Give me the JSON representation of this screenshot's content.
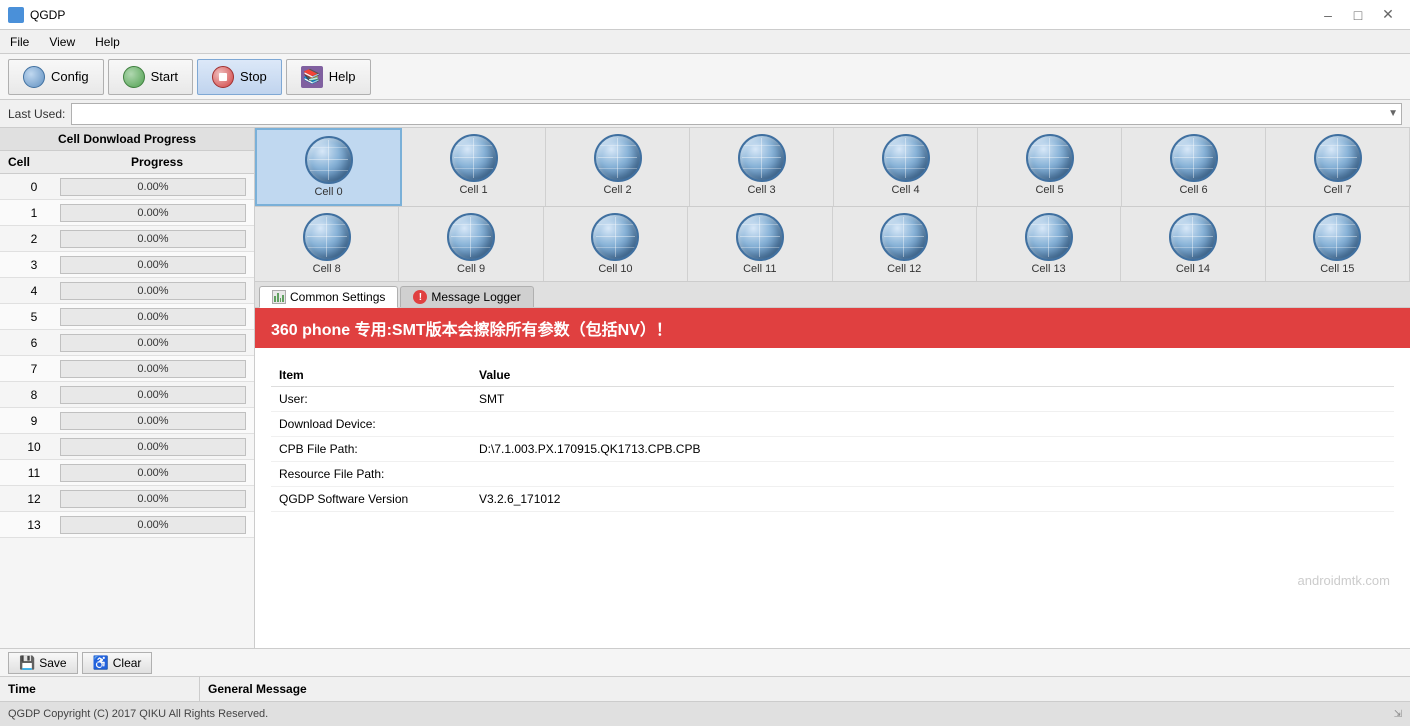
{
  "app": {
    "title": "QGDP",
    "menu": [
      "File",
      "View",
      "Help"
    ]
  },
  "toolbar": {
    "config_label": "Config",
    "start_label": "Start",
    "stop_label": "Stop",
    "help_label": "Help"
  },
  "last_used": {
    "label": "Last Used:",
    "value": "",
    "placeholder": ""
  },
  "left_panel": {
    "title": "Cell Donwload Progress",
    "header_cell": "Cell",
    "header_progress": "Progress",
    "cells": [
      {
        "num": 0,
        "progress": "0.00%"
      },
      {
        "num": 1,
        "progress": "0.00%"
      },
      {
        "num": 2,
        "progress": "0.00%"
      },
      {
        "num": 3,
        "progress": "0.00%"
      },
      {
        "num": 4,
        "progress": "0.00%"
      },
      {
        "num": 5,
        "progress": "0.00%"
      },
      {
        "num": 6,
        "progress": "0.00%"
      },
      {
        "num": 7,
        "progress": "0.00%"
      },
      {
        "num": 8,
        "progress": "0.00%"
      },
      {
        "num": 9,
        "progress": "0.00%"
      },
      {
        "num": 10,
        "progress": "0.00%"
      },
      {
        "num": 11,
        "progress": "0.00%"
      },
      {
        "num": 12,
        "progress": "0.00%"
      },
      {
        "num": 13,
        "progress": "0.00%"
      }
    ]
  },
  "cell_grid_row1": [
    {
      "name": "Cell 0",
      "active": true
    },
    {
      "name": "Cell 1"
    },
    {
      "name": "Cell 2"
    },
    {
      "name": "Cell 3"
    },
    {
      "name": "Cell 4"
    },
    {
      "name": "Cell 5"
    },
    {
      "name": "Cell 6"
    },
    {
      "name": "Cell 7"
    }
  ],
  "cell_grid_row2": [
    {
      "name": "Cell 8"
    },
    {
      "name": "Cell 9"
    },
    {
      "name": "Cell 10"
    },
    {
      "name": "Cell 11"
    },
    {
      "name": "Cell 12"
    },
    {
      "name": "Cell 13"
    },
    {
      "name": "Cell 14"
    },
    {
      "name": "Cell 15"
    }
  ],
  "tabs": [
    {
      "id": "common",
      "label": "Common Settings",
      "active": true
    },
    {
      "id": "logger",
      "label": "Message Logger"
    }
  ],
  "warning_banner": "360 phone 专用:SMT版本会擦除所有参数（包括NV）！",
  "settings": {
    "col_item": "Item",
    "col_value": "Value",
    "rows": [
      {
        "item": "User:",
        "value": "SMT"
      },
      {
        "item": "Download Device:",
        "value": ""
      },
      {
        "item": "CPB File Path:",
        "value": "D:\\7.1.003.PX.170915.QK1713.CPB.CPB"
      },
      {
        "item": "Resource File Path:",
        "value": ""
      },
      {
        "item": "QGDP Software Version",
        "value": "V3.2.6_171012"
      }
    ]
  },
  "watermark": "androidmtk.com",
  "log_bar": {
    "save_label": "Save",
    "clear_label": "Clear"
  },
  "log_columns": {
    "time": "Time",
    "message": "General Message"
  },
  "status_bar": {
    "copyright": "QGDP Copyright (C) 2017 QIKU All Rights Reserved."
  }
}
